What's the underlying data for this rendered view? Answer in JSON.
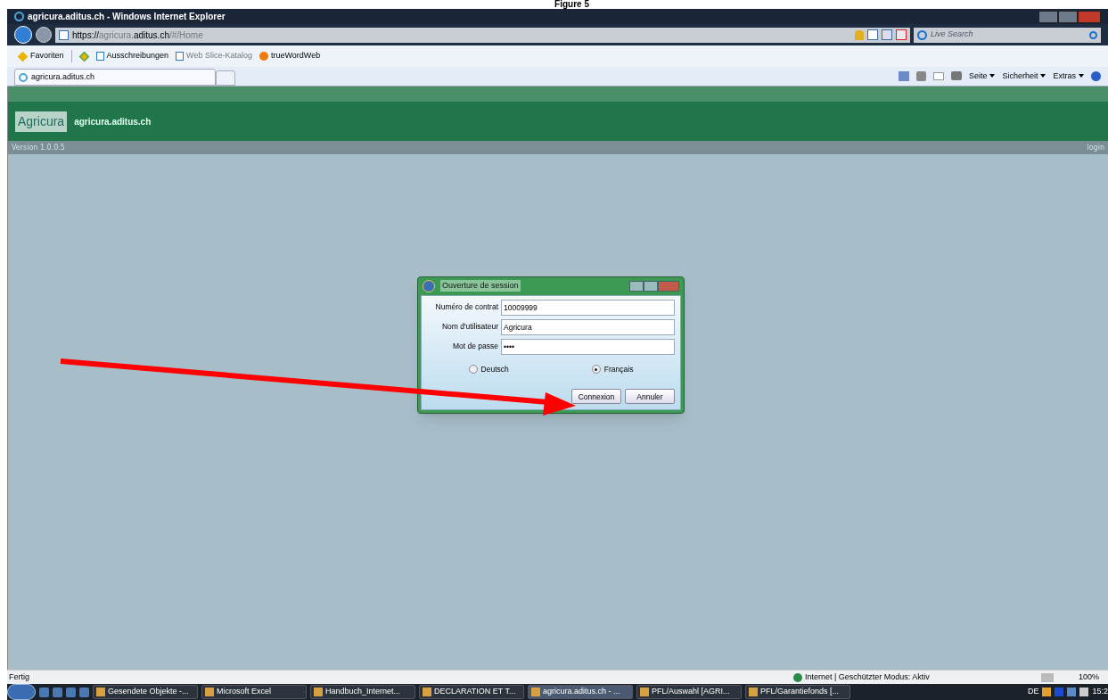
{
  "caption": "Figure 5",
  "window": {
    "title": "agricura.aditus.ch - Windows Internet Explorer"
  },
  "address_bar": {
    "scheme": "https://",
    "host_pre": "agricura.",
    "host": "aditus.ch",
    "path": "/#/Home"
  },
  "search": {
    "placeholder": "Live Search"
  },
  "favorites_bar": [
    {
      "kind": "star",
      "label": "Favoriten"
    },
    {
      "kind": "page",
      "label": "Ausschreibungen",
      "dim": false
    },
    {
      "kind": "page",
      "label": "Web Slice-Katalog",
      "dim": true
    },
    {
      "kind": "fire",
      "label": "trueWordWeb",
      "dim": false
    }
  ],
  "tabs": [
    {
      "label": "agricura.aditus.ch",
      "selected": true
    }
  ],
  "command_bar": [
    "Seite",
    "Sicherheit",
    "Extras"
  ],
  "site": {
    "logo": "Agricura",
    "title": "agricura.aditus.ch",
    "version": "Version 1.0.0.5",
    "login": "login"
  },
  "dialog": {
    "title": "Ouverture de session",
    "fields": [
      {
        "label": "Numéro de contrat",
        "value": "10009999"
      },
      {
        "label": "Nom d'utilisateur",
        "value": "Agricura"
      },
      {
        "label": "Mot de passe",
        "value": "••••"
      }
    ],
    "languages": [
      {
        "label": "Deutsch",
        "selected": false
      },
      {
        "label": "Français",
        "selected": true
      }
    ],
    "buttons": [
      "Connexion",
      "Annuler"
    ]
  },
  "status_bar": {
    "text": "Fertig",
    "zone": "Internet | Geschützter Modus: Aktiv",
    "zoom": "100%"
  },
  "taskbar": {
    "items": [
      {
        "label": "Gesendete Objekte -...",
        "selected": false
      },
      {
        "label": "Microsoft Excel",
        "selected": false
      },
      {
        "label": "Handbuch_Internet...",
        "selected": false
      },
      {
        "label": "DECLARATION ET T...",
        "selected": false
      },
      {
        "label": "agricura.aditus.ch - ...",
        "selected": true
      },
      {
        "label": "PFL/Auswahl [AGRI...",
        "selected": false
      },
      {
        "label": "PFL/Garantiefonds [...",
        "selected": false
      }
    ],
    "language": "DE",
    "clock": "15:2"
  }
}
